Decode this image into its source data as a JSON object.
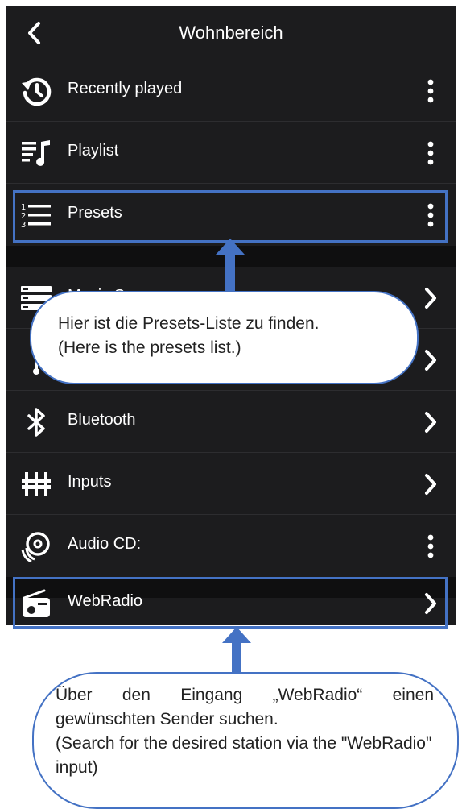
{
  "header": {
    "title": "Wohnbereich",
    "back_icon": "chevron-left-icon"
  },
  "menu": {
    "group1": [
      {
        "label": "Recently played",
        "icon": "history-icon",
        "action": "more-vertical-icon"
      },
      {
        "label": "Playlist",
        "icon": "playlist-icon",
        "action": "more-vertical-icon"
      },
      {
        "label": "Presets",
        "icon": "presets-list-icon",
        "action": "more-vertical-icon"
      }
    ],
    "group2": [
      {
        "label": "Music Server",
        "icon": "server-icon",
        "action": "chevron-right-icon"
      },
      {
        "label": "",
        "icon": "usb-icon",
        "action": "chevron-right-icon"
      },
      {
        "label": "Bluetooth",
        "icon": "bluetooth-icon",
        "action": "chevron-right-icon"
      },
      {
        "label": "Inputs",
        "icon": "inputs-icon",
        "action": "chevron-right-icon"
      },
      {
        "label": "Audio CD:",
        "icon": "audio-cd-icon",
        "action": "more-vertical-icon"
      }
    ],
    "group3": [
      {
        "label": "WebRadio",
        "icon": "radio-icon",
        "action": "chevron-right-icon"
      },
      {
        "label": "",
        "icon": "podcast-icon",
        "action": "chevron-right-icon"
      }
    ]
  },
  "annotations": {
    "callout1": {
      "line1": "Hier ist die Presets-Liste zu finden.",
      "line2": "(Here is the presets list.)"
    },
    "callout2": {
      "line1": "Über den Eingang „WebRadio“ einen gewünschten Sender suchen.",
      "line2": "(Search for the desired station via the \"WebRadio\" input)"
    },
    "accent_color": "#4472c4"
  },
  "colors": {
    "background": "#1c1c1e",
    "text": "#ffffff",
    "separator": "#0f0f10"
  }
}
